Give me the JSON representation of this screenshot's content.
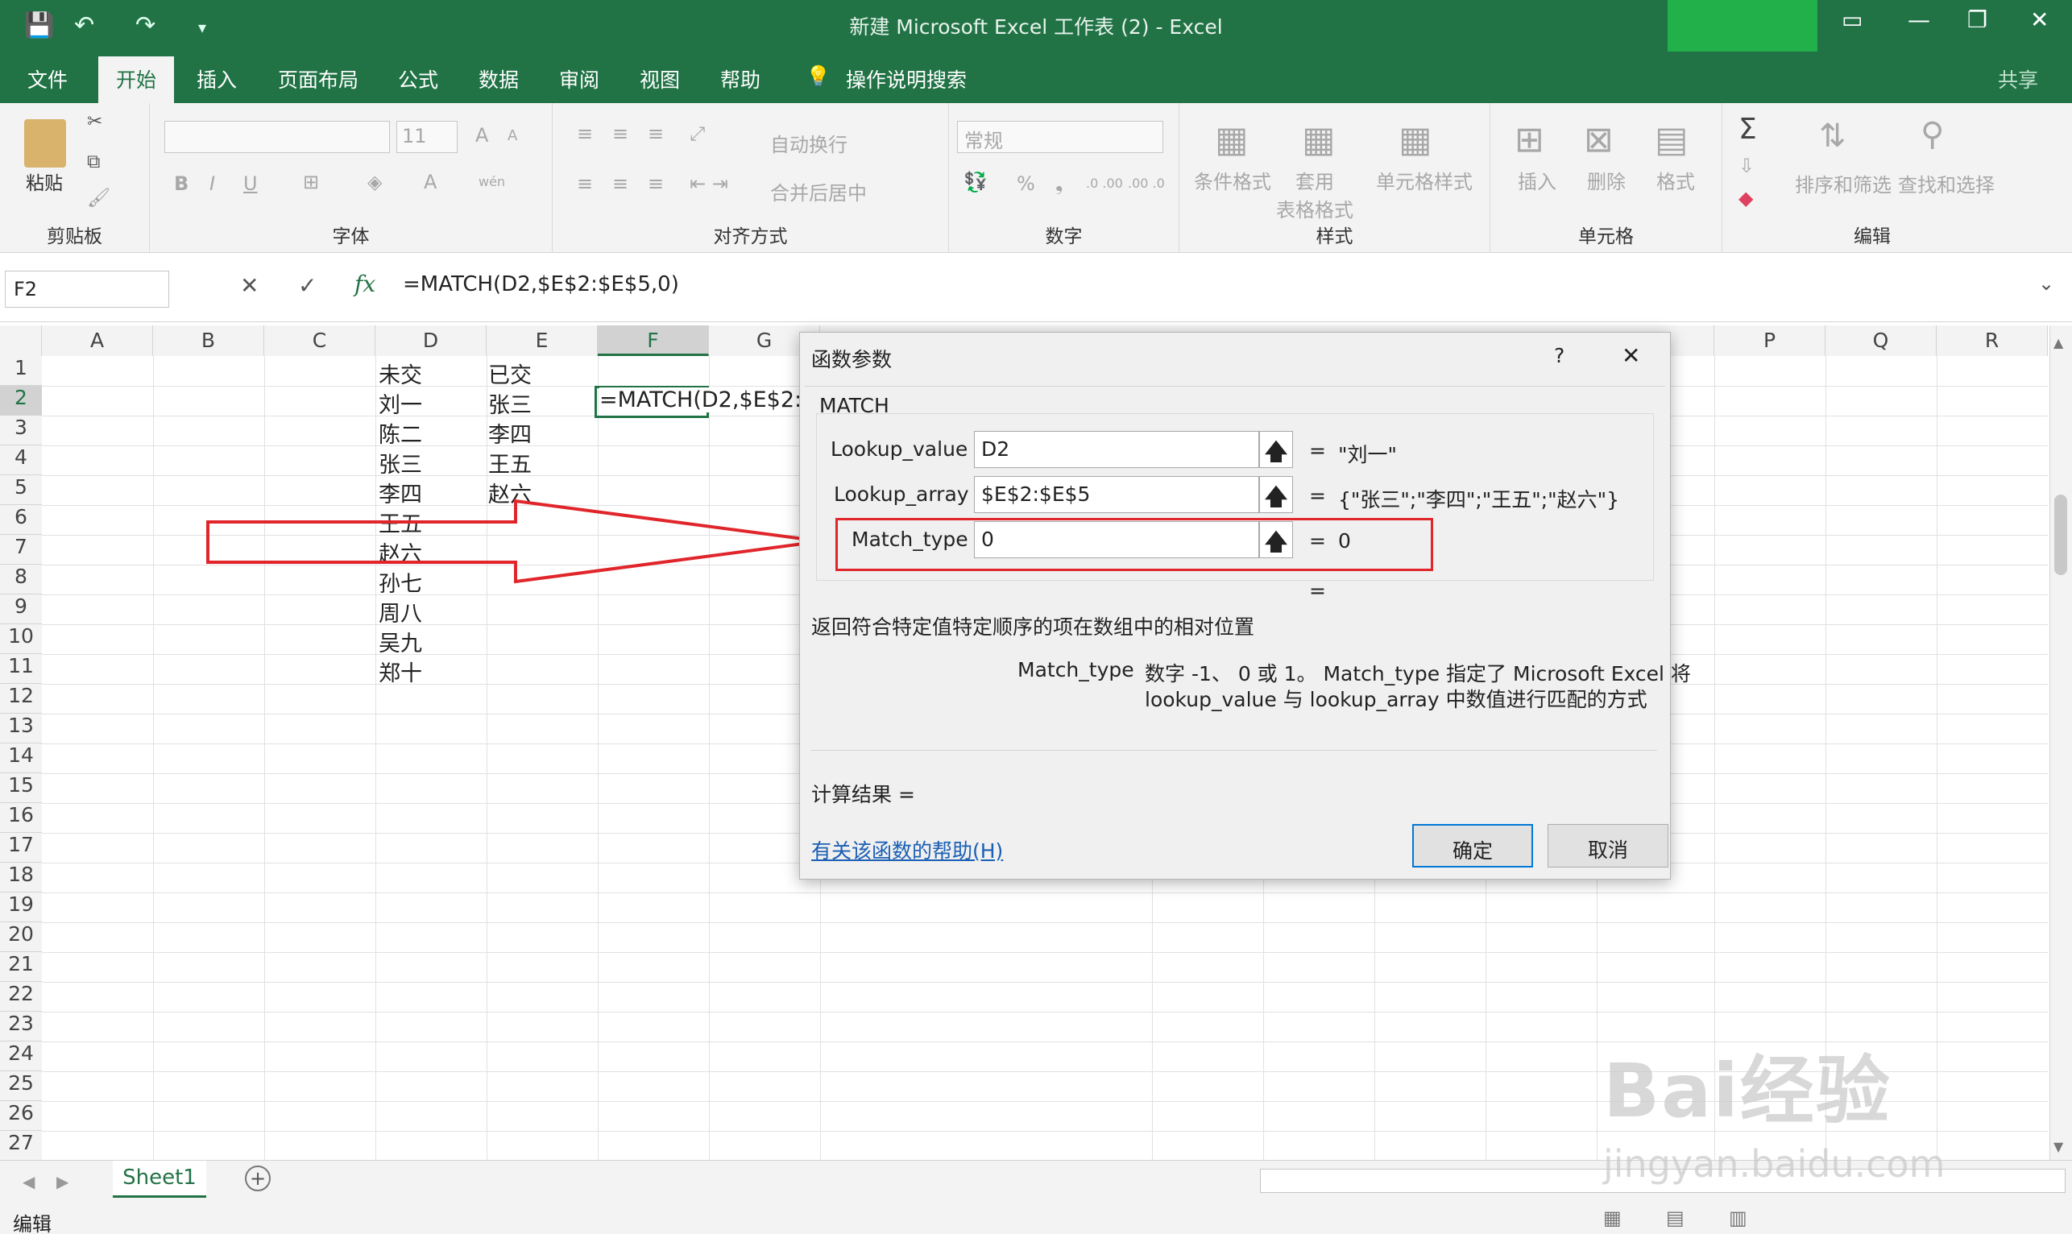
{
  "window": {
    "title": "新建 Microsoft Excel 工作表 (2)  -  Excel",
    "qat": {
      "save": "💾",
      "undo": "↶",
      "redo": "↷",
      "more": "▾"
    },
    "controls": {
      "restore_ribbon": "▭",
      "minimize": "—",
      "maximize": "❐",
      "close": "✕"
    }
  },
  "menu": {
    "tabs": [
      "文件",
      "开始",
      "插入",
      "页面布局",
      "公式",
      "数据",
      "审阅",
      "视图",
      "帮助"
    ],
    "active": "开始",
    "tellme": "操作说明搜索",
    "share": "共享"
  },
  "ribbon": {
    "clipboard": {
      "label": "剪贴板",
      "paste": "粘贴"
    },
    "font": {
      "label": "字体",
      "size": "11",
      "bold": "B",
      "italic": "I",
      "underline": "U",
      "grow": "A",
      "shrink": "A",
      "color": "A",
      "wen": "wén"
    },
    "alignment": {
      "label": "对齐方式",
      "wrap": "自动换行",
      "merge": "合并后居中"
    },
    "number": {
      "label": "数字",
      "format": "常规",
      "percent": "%",
      "comma": "❟",
      "inc": ".0 .00",
      "dec": ".00 .0"
    },
    "styles": {
      "label": "样式",
      "cond": "条件格式",
      "table": "套用\n表格格式",
      "cell": "单元格样式"
    },
    "cells": {
      "label": "单元格",
      "insert": "插入",
      "delete": "删除",
      "format": "格式"
    },
    "editing": {
      "label": "编辑",
      "sort": "排序和筛选",
      "find": "查找和选择",
      "sum": "Σ"
    }
  },
  "formula_bar": {
    "name_box": "F2",
    "cancel": "✕",
    "enter": "✓",
    "fx": "fx",
    "formula": "=MATCH(D2,$E$2:$E$5,0)"
  },
  "grid": {
    "columns": [
      "A",
      "B",
      "C",
      "D",
      "E",
      "F",
      "G",
      "P",
      "Q",
      "R"
    ],
    "rows": [
      "1",
      "2",
      "3",
      "4",
      "5",
      "6",
      "7",
      "8",
      "9",
      "10",
      "11",
      "12",
      "13",
      "14",
      "15",
      "16",
      "17",
      "18",
      "19",
      "20",
      "21",
      "22",
      "23",
      "24",
      "25",
      "26",
      "27"
    ],
    "colD": [
      "未交",
      "刘一",
      "陈二",
      "张三",
      "李四",
      "王五",
      "赵六",
      "孙七",
      "周八",
      "吴九",
      "郑十"
    ],
    "colE": [
      "已交",
      "张三",
      "李四",
      "王五",
      "赵六"
    ],
    "F2": "=MATCH(D2,$E$2:$E"
  },
  "sheets": {
    "tabs": [
      "Sheet1"
    ],
    "add": "+"
  },
  "status": {
    "mode": "编辑"
  },
  "dialog": {
    "title": "函数参数",
    "help_q": "?",
    "close": "✕",
    "function": "MATCH",
    "args": [
      {
        "name": "Lookup_value",
        "value": "D2",
        "result": "\"刘一\""
      },
      {
        "name": "Lookup_array",
        "value": "$E$2:$E$5",
        "result": "{\"张三\";\"李四\";\"王五\";\"赵六\"}"
      },
      {
        "name": "Match_type",
        "value": "0",
        "result": "0"
      }
    ],
    "eq": "=",
    "description": "返回符合特定值特定顺序的项在数组中的相对位置",
    "arg_help_name": "Match_type",
    "arg_help_line1": "数字 -1、 0 或 1。 Match_type 指定了 Microsoft Excel 将",
    "arg_help_line2": "lookup_value 与 lookup_array 中数值进行匹配的方式",
    "calc_result": "计算结果 =",
    "help_link": "有关该函数的帮助(H)",
    "ok": "确定",
    "cancel": "取消"
  },
  "watermark": {
    "text": "Bai经验",
    "url": "jingyan.baidu.com"
  },
  "colors": {
    "excel_green": "#217346",
    "annotation_red": "#e0262b",
    "link_blue": "#1a5fb4"
  }
}
